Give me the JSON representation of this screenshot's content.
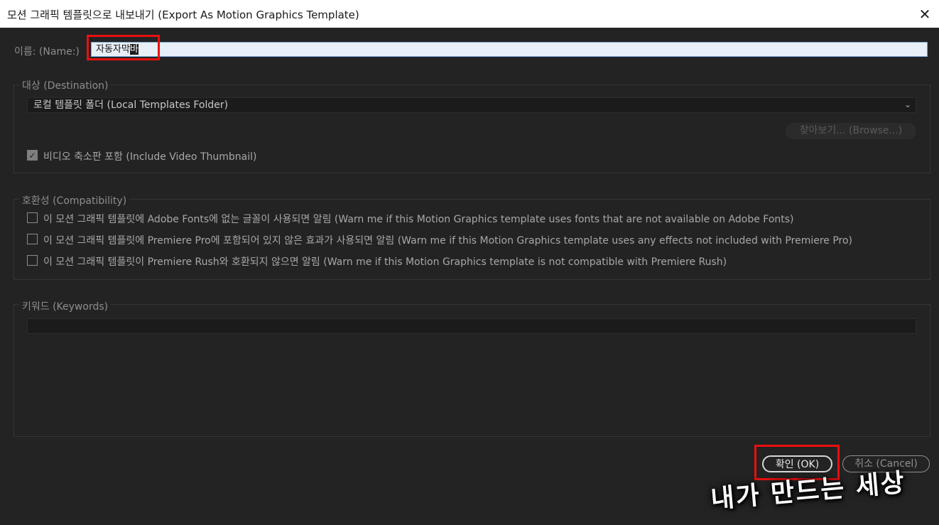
{
  "window": {
    "title": "모션 그래픽 템플릿으로 내보내기 (Export As Motion Graphics Template)",
    "close_glyph": "✕"
  },
  "name": {
    "label": "이름: (Name:)",
    "value_prefix": "자동자막",
    "value_selected": "바"
  },
  "destination": {
    "legend": "대상 (Destination)",
    "selected": "로컬 템플릿 폴더 (Local Templates Folder)",
    "browse_label": "찾아보기... (Browse...)",
    "thumbnail_label": "비디오 축소판 포함 (Include Video Thumbnail)",
    "thumbnail_checked": true
  },
  "compatibility": {
    "legend": "호환성 (Compatibility)",
    "options": [
      {
        "label": "이 모션 그래픽 템플릿에 Adobe Fonts에 없는 글꼴이 사용되면 알림 (Warn me if this Motion Graphics template uses fonts that are not available on Adobe Fonts)",
        "checked": false
      },
      {
        "label": "이 모션 그래픽 템플릿에 Premiere Pro에 포함되어 있지 않은 효과가 사용되면 알림 (Warn me if this Motion Graphics template uses any effects not included with Premiere Pro)",
        "checked": false
      },
      {
        "label": "이 모션 그래픽 템플릿이 Premiere Rush와 호환되지 않으면 알림 (Warn me if this Motion Graphics template is not compatible with Premiere Rush)",
        "checked": false
      }
    ]
  },
  "keywords": {
    "legend": "키워드 (Keywords)",
    "value": ""
  },
  "buttons": {
    "ok": "확인 (OK)",
    "cancel": "취소 (Cancel)"
  },
  "watermark": "내가 만드는 세상",
  "colors": {
    "background": "#232323",
    "highlight": "#e81010",
    "titlebar": "#ffffff"
  }
}
